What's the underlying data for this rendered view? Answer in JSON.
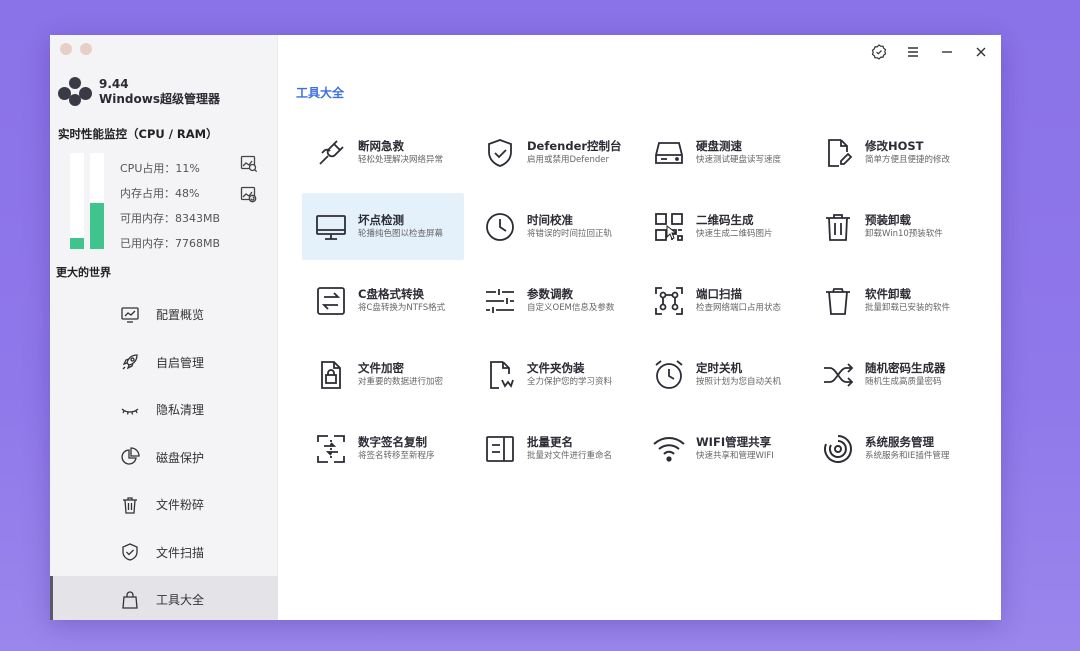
{
  "app": {
    "version": "9.44",
    "name": "Windows超级管理器"
  },
  "perf": {
    "title": "实时性能监控（CPU / RAM）",
    "cpu_percent": 11,
    "ram_percent": 48,
    "cpu_label": "CPU占用：11%",
    "ram_label": "内存占用：48%",
    "avail_label": "可用内存：8343MB",
    "used_label": "已用内存：7768MB",
    "bar_color": "#3ec48c"
  },
  "more_world": "更大的世界",
  "nav": [
    {
      "label": "配置概览",
      "icon": "monitor-chart-icon"
    },
    {
      "label": "自启管理",
      "icon": "rocket-icon"
    },
    {
      "label": "隐私清理",
      "icon": "eye-closed-icon"
    },
    {
      "label": "磁盘保护",
      "icon": "pie-chart-icon"
    },
    {
      "label": "文件粉碎",
      "icon": "trash-icon"
    },
    {
      "label": "文件扫描",
      "icon": "shield-check-icon"
    },
    {
      "label": "工具大全",
      "icon": "bag-icon",
      "active": true
    }
  ],
  "section_title": "工具大全",
  "tools": [
    {
      "name": "断网急救",
      "desc": "轻松处理解决网络异常",
      "icon": "plug-icon"
    },
    {
      "name": "Defender控制台",
      "desc": "启用或禁用Defender",
      "icon": "shield-check-icon"
    },
    {
      "name": "硬盘测速",
      "desc": "快速测试硬盘读写速度",
      "icon": "hard-drive-icon"
    },
    {
      "name": "修改HOST",
      "desc": "简单方便且便捷的修改",
      "icon": "file-edit-icon"
    },
    {
      "name": "坏点检测",
      "desc": "轮播纯色图以检查屏幕",
      "icon": "monitor-icon"
    },
    {
      "name": "时间校准",
      "desc": "将错误的时间拉回正轨",
      "icon": "clock-icon"
    },
    {
      "name": "二维码生成",
      "desc": "快速生成二维码图片",
      "icon": "qrcode-icon"
    },
    {
      "name": "预装卸载",
      "desc": "卸载Win10预装软件",
      "icon": "trash-icon"
    },
    {
      "name": "C盘格式转换",
      "desc": "将C盘转换为NTFS格式",
      "icon": "convert-icon"
    },
    {
      "name": "参数调教",
      "desc": "自定义OEM信息及参数",
      "icon": "sliders-icon"
    },
    {
      "name": "端口扫描",
      "desc": "检查网络端口占用状态",
      "icon": "scan-icon"
    },
    {
      "name": "软件卸载",
      "desc": "批量卸载已安装的软件",
      "icon": "bin-icon"
    },
    {
      "name": "文件加密",
      "desc": "对重要的数据进行加密",
      "icon": "file-lock-icon"
    },
    {
      "name": "文件夹伪装",
      "desc": "全力保护您的学习资料",
      "icon": "file-mask-icon"
    },
    {
      "name": "定时关机",
      "desc": "按照计划为您自动关机",
      "icon": "alarm-clock-icon"
    },
    {
      "name": "随机密码生成器",
      "desc": "随机生成高质量密码",
      "icon": "shuffle-icon"
    },
    {
      "name": "数字签名复制",
      "desc": "将签名转移至新程序",
      "icon": "signature-copy-icon"
    },
    {
      "name": "批量更名",
      "desc": "批量对文件进行重命名",
      "icon": "rename-icon"
    },
    {
      "name": "WIFI管理共享",
      "desc": "快速共享和管理WIFI",
      "icon": "wifi-icon"
    },
    {
      "name": "系统服务管理",
      "desc": "系统服务和IE插件管理",
      "icon": "service-ring-icon"
    }
  ],
  "hover_tool_index": 4
}
